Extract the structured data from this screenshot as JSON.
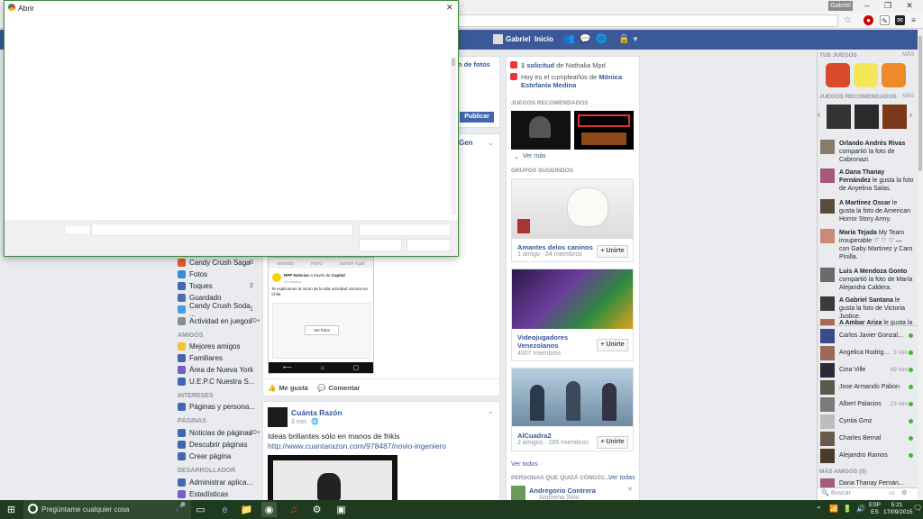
{
  "browser": {
    "user_chip": "Gabriel",
    "window_controls": [
      "–",
      "❐",
      "✕"
    ]
  },
  "fb_header": {
    "user": "Gabriel",
    "home": "Inicio"
  },
  "left_nav": {
    "apps": [
      {
        "label": "Candy Crush Saga",
        "count": "8",
        "color": "#e05a2b"
      },
      {
        "label": "Fotos",
        "count": "",
        "color": "#3b8bd6"
      },
      {
        "label": "Toques",
        "count": "2",
        "color": "#4267b2"
      },
      {
        "label": "Guardado",
        "count": "",
        "color": "#4b6fb5"
      },
      {
        "label": "Candy Crush Soda ...",
        "count": "1",
        "color": "#47a0d8"
      },
      {
        "label": "Actividad en juegos",
        "count": "20+",
        "color": "#8a8d91"
      }
    ],
    "friends_header": "AMIGOS",
    "friends": [
      {
        "label": "Mejores amigos",
        "color": "#f5c33b"
      },
      {
        "label": "Familiares",
        "color": "#4267b2"
      },
      {
        "label": "Área de Nueva York",
        "color": "#7a5cc9"
      },
      {
        "label": "U.E.P.C Nuestra S...",
        "color": "#4267b2"
      }
    ],
    "interests_header": "INTERESES",
    "interests": [
      {
        "label": "Páginas y persona...",
        "color": "#4267b2"
      }
    ],
    "pages_header": "PÁGINAS",
    "pages": [
      {
        "label": "Noticias de páginas",
        "count": "20+",
        "color": "#4267b2"
      },
      {
        "label": "Descubrir páginas",
        "count": "",
        "color": "#4267b2"
      },
      {
        "label": "Crear página",
        "count": "",
        "color": "#4267b2"
      }
    ],
    "dev_header": "DESARROLLADOR",
    "dev": [
      {
        "label": "Administrar aplica...",
        "color": "#4267b2"
      },
      {
        "label": "Estadísticas",
        "color": "#7a5cc9"
      }
    ]
  },
  "feed": {
    "composer_tab": "n de fotos",
    "publish": "Publicar",
    "post1_title_fragment": "Gen",
    "phone": {
      "tabs": [
        "ESTADO",
        "FOTO",
        "ESTOY AQUÍ"
      ],
      "page_line_a": "RPP Noticias",
      "page_line_b": " a través de ",
      "page_line_c": "Capital",
      "page_sub": "40 minutos",
      "body": "Te explicamos la razón de la alta actividad sísmica en Chile.",
      "button": "Ver fotos"
    },
    "actions": {
      "like": "Me gusta",
      "comment": "Comentar"
    },
    "post2": {
      "author": "Cuánta Razón",
      "time": "3 min",
      "text": "Ideas brillantes sólo en manos de frikis",
      "link": "http://www.cuantarazon.com/978487/novio-ingeniero"
    }
  },
  "right_col": {
    "requests": {
      "count": "1 solicitud",
      "rest": " de Nathalia Mpd"
    },
    "birthday": {
      "pre": "Hoy es el cumpleaños de ",
      "name": "Mónica Estefanía Medina"
    },
    "games_header": "JUEGOS RECOMENDADOS",
    "see_more": "Ver más",
    "groups_header": "GRUPOS SUGERIDOS",
    "groups": [
      {
        "name": "Amantes delos caninos",
        "meta": "1 amigo · 64 miembros",
        "join": "+ Unirte"
      },
      {
        "name": "Videojugadores Venezolanos",
        "meta": "4007 miembros",
        "join": "+ Unirte"
      },
      {
        "name": "AlCuadra2",
        "meta": "2 amigos · 285 miembros",
        "join": "+ Unirte"
      }
    ],
    "see_all": "Ver todos",
    "pymk_header": "PERSONAS QUE QUIZÁ CONOZC...",
    "pymk_see_all": "Ver todas",
    "pymk_person": {
      "name": "Andregorio Contrera",
      "sub": "Andreina Soto"
    }
  },
  "sidebar": {
    "your_games": "TUS JUEGOS",
    "more": "MÁS",
    "recommended": "JUEGOS RECOMENDADOS",
    "ticker": [
      {
        "name": "Orlando Andrés Rivas",
        "text": " compartió la foto de Cabronazi."
      },
      {
        "name": "A Dana Thanay Fernández",
        "text": " le gusta la foto de Anyelina Salas."
      },
      {
        "name": "A Martínez Oscar",
        "text": " le gusta la foto de American Horror Story Army."
      },
      {
        "name": "María Tejada",
        "text": " My Team insuperable ♡ ♡ ♡ — con Gaby Martinez y Caro Pinilla."
      },
      {
        "name": "Luis A Mendoza Gonto",
        "text": " compartió la foto de María Alejandra Caldera."
      },
      {
        "name": "A Gabriel Santana",
        "text": " le gusta la foto de Victoria Justice."
      },
      {
        "name": "A Ambar Ariza",
        "text": " le gusta la"
      }
    ],
    "chat": [
      {
        "name": "Carlos Javier Gonzal...",
        "time": "",
        "online": true
      },
      {
        "name": "Angelica Rodrig...",
        "time": "3 min",
        "online": true
      },
      {
        "name": "Cina Ville",
        "time": "49 min",
        "online": true
      },
      {
        "name": "Jose Armando Pabon",
        "time": "",
        "online": true
      },
      {
        "name": "Albert Palacios",
        "time": "23 min",
        "online": true
      },
      {
        "name": "Cyntia Gmz",
        "time": "",
        "online": true
      },
      {
        "name": "Charles Bernal",
        "time": "",
        "online": true
      },
      {
        "name": "Alejandro Ramos",
        "time": "",
        "online": true
      }
    ],
    "more_friends": "MÁS AMIGOS (9)",
    "more_friend": "Dana Thanay Fernán...",
    "search_placeholder": "Buscar"
  },
  "dialog": {
    "title": "Abrir",
    "close": "✕"
  },
  "taskbar": {
    "search_placeholder": "Pregúntame cualquier cosa",
    "lang_top": "ESP",
    "lang_bottom": "ES",
    "time": "5:21",
    "date": "17/09/2015"
  }
}
